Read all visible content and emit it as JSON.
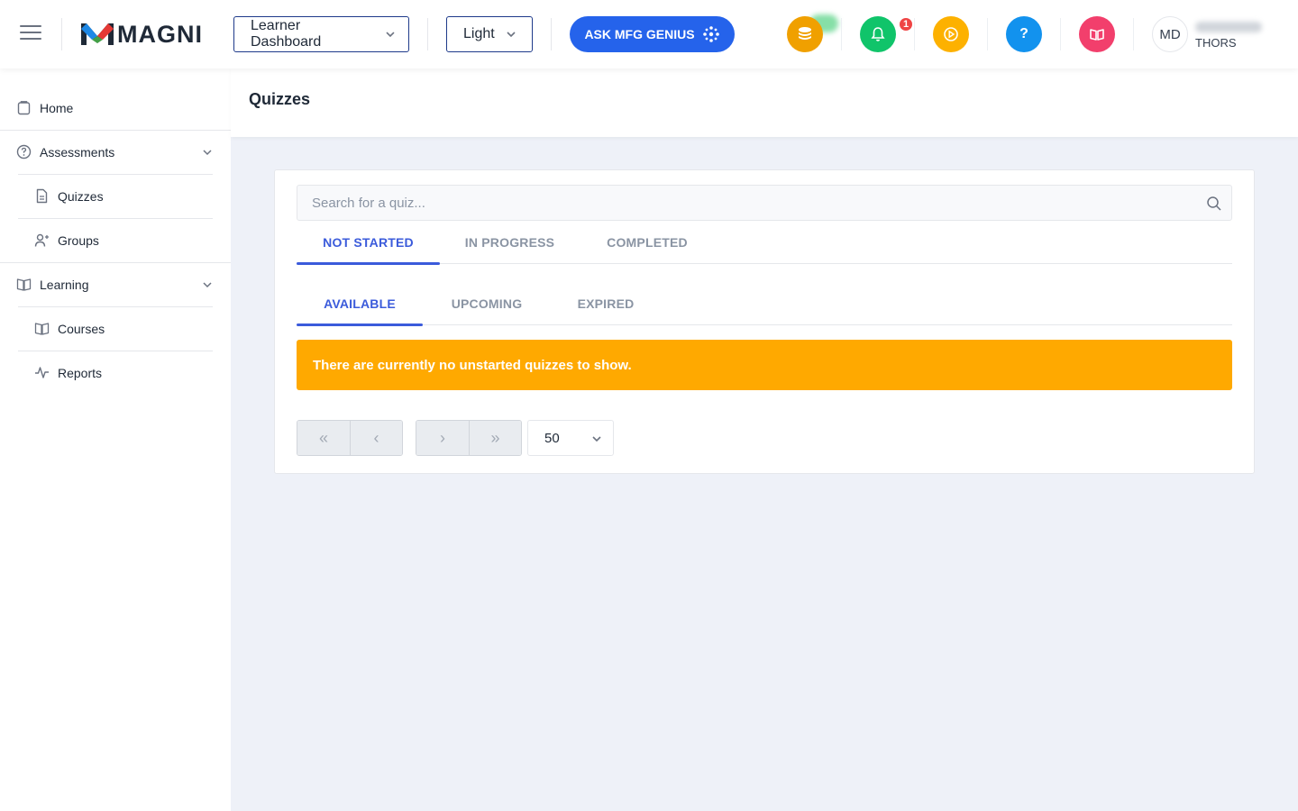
{
  "header": {
    "brand": "MAGNI",
    "dashboard_select": "Learner Dashboard",
    "theme_select": "Light",
    "ask_button": "ASK MFG GENIUS",
    "notification_count": "1",
    "avatar_initials": "MD",
    "user_org": "THORS",
    "icons": [
      "coins-icon",
      "bell-icon",
      "play-icon",
      "help-icon",
      "book-open-icon"
    ],
    "colors": {
      "coins": "#f0a000",
      "bell": "#10c46a",
      "play": "#fdb100",
      "help": "#1292ee",
      "book": "#f23f6c",
      "accent": "#2563eb"
    }
  },
  "sidebar": {
    "items": [
      {
        "label": "Home",
        "icon": "clipboard-icon"
      },
      {
        "label": "Assessments",
        "icon": "question-circle-icon"
      },
      {
        "label": "Quizzes",
        "icon": "document-icon"
      },
      {
        "label": "Groups",
        "icon": "user-plus-icon"
      },
      {
        "label": "Learning",
        "icon": "book-icon"
      },
      {
        "label": "Courses",
        "icon": "book-icon"
      },
      {
        "label": "Reports",
        "icon": "activity-icon"
      }
    ]
  },
  "page": {
    "title": "Quizzes",
    "search_placeholder": "Search for a quiz...",
    "status_tabs": [
      "NOT STARTED",
      "IN PROGRESS",
      "COMPLETED"
    ],
    "availability_tabs": [
      "AVAILABLE",
      "UPCOMING",
      "EXPIRED"
    ],
    "empty_message": "There are currently no unstarted quizzes to show.",
    "pagination": {
      "first": "«",
      "prev": "‹",
      "next": "›",
      "last": "»",
      "per_page": "50"
    }
  }
}
